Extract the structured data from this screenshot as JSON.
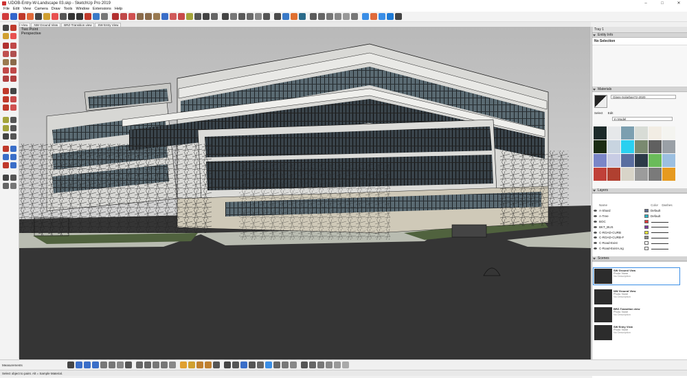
{
  "window": {
    "title": "UDOB-Entry-W-Landscape 03.skp - SketchUp Pro 2019",
    "controls": [
      "–",
      "□",
      "✕"
    ]
  },
  "menu": [
    "File",
    "Edit",
    "View",
    "Camera",
    "Draw",
    "Tools",
    "Window",
    "Extensions",
    "Help"
  ],
  "scene_tabs": [
    "SW Ground View",
    "NW Ground View",
    "BRZ-Transition view",
    "SW Entry View"
  ],
  "viewport": {
    "camera_line1": "Two Point",
    "camera_line2": "Perspective"
  },
  "tray": {
    "title": "Tray 1",
    "entity_info": {
      "header": "Entity Info",
      "selection": "No Selection"
    },
    "materials": {
      "header": "Materials",
      "material_name": "Glass-Solarban72-2020",
      "tab_select": "Select",
      "tab_edit": "Edit",
      "collection": "In Model",
      "swatch_colors": [
        "#1c2a2a",
        "#e6e8ea",
        "#7c9fb0",
        "#d8dcd6",
        "#f2ede4",
        "#f4f4f0",
        "#1b2c14",
        "#c8d4e0",
        "#2ad0f0",
        "#7a8a70",
        "#606060",
        "#9aa0a6",
        "#7a86c8",
        "#c8cce4",
        "#5a6ea0",
        "#2c3a48",
        "#6abb5a",
        "#9cbfe0",
        "#c04038",
        "#b04030",
        "#d8d4c8",
        "#9c9c9c",
        "#7a7a7a",
        "#e69a20"
      ]
    },
    "layers": {
      "header": "Layers",
      "col_name": "Name",
      "col_color": "Color",
      "col_dashes": "Dashes",
      "rows": [
        {
          "name": "A-Shard",
          "color": "#5f6a8e",
          "dashes": "Default"
        },
        {
          "name": "A-Tree",
          "color": "#2bb6c7",
          "dashes": "Default"
        },
        {
          "name": "BOC",
          "color": "#e03a3a",
          "dashes": ""
        },
        {
          "name": "BKT_BUS",
          "color": "#7a3aa0",
          "dashes": ""
        },
        {
          "name": "C-ROAD-CURB",
          "color": "#f4ef3a",
          "dashes": ""
        },
        {
          "name": "C-ROAD-CURB-F",
          "color": "#8a8a8a",
          "dashes": ""
        },
        {
          "name": "C-Road-Exist",
          "color": "#ffffff",
          "dashes": ""
        },
        {
          "name": "C-Road-Exist-Lng",
          "color": "#ffffff",
          "dashes": ""
        }
      ]
    },
    "scenes": {
      "header": "Scenes",
      "items": [
        {
          "name": "SW Ground View",
          "prop": "Photo: None",
          "desc": "No Description"
        },
        {
          "name": "NW Ground View",
          "prop": "Photo: None",
          "desc": "No Description"
        },
        {
          "name": "BRZ-Transition view",
          "prop": "Photo: None",
          "desc": "No Description"
        },
        {
          "name": "SW Entry View",
          "prop": "Photo: None",
          "desc": "No Description"
        }
      ]
    }
  },
  "measurements_label": "Measurements",
  "status_text": "Select object to paint. Alt = Sample Material."
}
